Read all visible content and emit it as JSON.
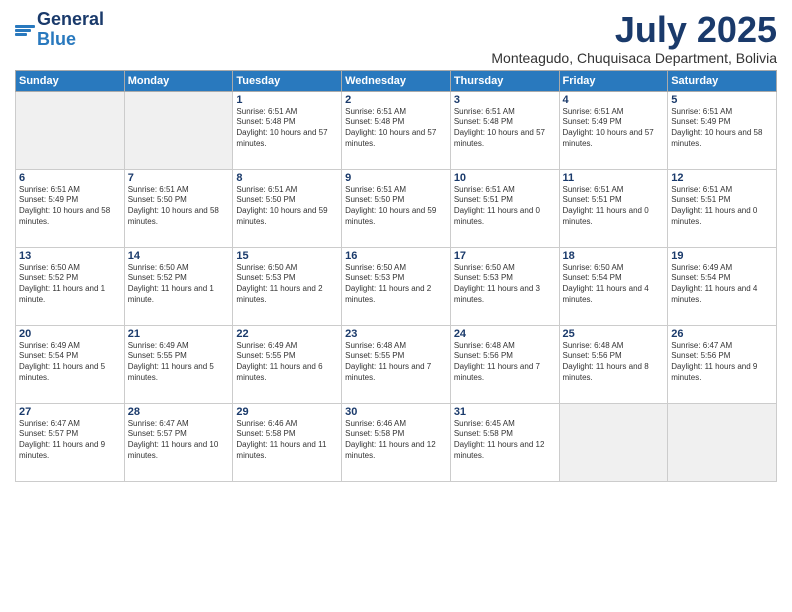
{
  "header": {
    "logo_general": "General",
    "logo_blue": "Blue",
    "month": "July 2025",
    "location": "Monteagudo, Chuquisaca Department, Bolivia"
  },
  "days_of_week": [
    "Sunday",
    "Monday",
    "Tuesday",
    "Wednesday",
    "Thursday",
    "Friday",
    "Saturday"
  ],
  "weeks": [
    [
      {
        "day": "",
        "empty": true
      },
      {
        "day": "",
        "empty": true
      },
      {
        "day": "1",
        "sunrise": "Sunrise: 6:51 AM",
        "sunset": "Sunset: 5:48 PM",
        "daylight": "Daylight: 10 hours and 57 minutes."
      },
      {
        "day": "2",
        "sunrise": "Sunrise: 6:51 AM",
        "sunset": "Sunset: 5:48 PM",
        "daylight": "Daylight: 10 hours and 57 minutes."
      },
      {
        "day": "3",
        "sunrise": "Sunrise: 6:51 AM",
        "sunset": "Sunset: 5:48 PM",
        "daylight": "Daylight: 10 hours and 57 minutes."
      },
      {
        "day": "4",
        "sunrise": "Sunrise: 6:51 AM",
        "sunset": "Sunset: 5:49 PM",
        "daylight": "Daylight: 10 hours and 57 minutes."
      },
      {
        "day": "5",
        "sunrise": "Sunrise: 6:51 AM",
        "sunset": "Sunset: 5:49 PM",
        "daylight": "Daylight: 10 hours and 58 minutes."
      }
    ],
    [
      {
        "day": "6",
        "sunrise": "Sunrise: 6:51 AM",
        "sunset": "Sunset: 5:49 PM",
        "daylight": "Daylight: 10 hours and 58 minutes."
      },
      {
        "day": "7",
        "sunrise": "Sunrise: 6:51 AM",
        "sunset": "Sunset: 5:50 PM",
        "daylight": "Daylight: 10 hours and 58 minutes."
      },
      {
        "day": "8",
        "sunrise": "Sunrise: 6:51 AM",
        "sunset": "Sunset: 5:50 PM",
        "daylight": "Daylight: 10 hours and 59 minutes."
      },
      {
        "day": "9",
        "sunrise": "Sunrise: 6:51 AM",
        "sunset": "Sunset: 5:50 PM",
        "daylight": "Daylight: 10 hours and 59 minutes."
      },
      {
        "day": "10",
        "sunrise": "Sunrise: 6:51 AM",
        "sunset": "Sunset: 5:51 PM",
        "daylight": "Daylight: 11 hours and 0 minutes."
      },
      {
        "day": "11",
        "sunrise": "Sunrise: 6:51 AM",
        "sunset": "Sunset: 5:51 PM",
        "daylight": "Daylight: 11 hours and 0 minutes."
      },
      {
        "day": "12",
        "sunrise": "Sunrise: 6:51 AM",
        "sunset": "Sunset: 5:51 PM",
        "daylight": "Daylight: 11 hours and 0 minutes."
      }
    ],
    [
      {
        "day": "13",
        "sunrise": "Sunrise: 6:50 AM",
        "sunset": "Sunset: 5:52 PM",
        "daylight": "Daylight: 11 hours and 1 minute."
      },
      {
        "day": "14",
        "sunrise": "Sunrise: 6:50 AM",
        "sunset": "Sunset: 5:52 PM",
        "daylight": "Daylight: 11 hours and 1 minute."
      },
      {
        "day": "15",
        "sunrise": "Sunrise: 6:50 AM",
        "sunset": "Sunset: 5:53 PM",
        "daylight": "Daylight: 11 hours and 2 minutes."
      },
      {
        "day": "16",
        "sunrise": "Sunrise: 6:50 AM",
        "sunset": "Sunset: 5:53 PM",
        "daylight": "Daylight: 11 hours and 2 minutes."
      },
      {
        "day": "17",
        "sunrise": "Sunrise: 6:50 AM",
        "sunset": "Sunset: 5:53 PM",
        "daylight": "Daylight: 11 hours and 3 minutes."
      },
      {
        "day": "18",
        "sunrise": "Sunrise: 6:50 AM",
        "sunset": "Sunset: 5:54 PM",
        "daylight": "Daylight: 11 hours and 4 minutes."
      },
      {
        "day": "19",
        "sunrise": "Sunrise: 6:49 AM",
        "sunset": "Sunset: 5:54 PM",
        "daylight": "Daylight: 11 hours and 4 minutes."
      }
    ],
    [
      {
        "day": "20",
        "sunrise": "Sunrise: 6:49 AM",
        "sunset": "Sunset: 5:54 PM",
        "daylight": "Daylight: 11 hours and 5 minutes."
      },
      {
        "day": "21",
        "sunrise": "Sunrise: 6:49 AM",
        "sunset": "Sunset: 5:55 PM",
        "daylight": "Daylight: 11 hours and 5 minutes."
      },
      {
        "day": "22",
        "sunrise": "Sunrise: 6:49 AM",
        "sunset": "Sunset: 5:55 PM",
        "daylight": "Daylight: 11 hours and 6 minutes."
      },
      {
        "day": "23",
        "sunrise": "Sunrise: 6:48 AM",
        "sunset": "Sunset: 5:55 PM",
        "daylight": "Daylight: 11 hours and 7 minutes."
      },
      {
        "day": "24",
        "sunrise": "Sunrise: 6:48 AM",
        "sunset": "Sunset: 5:56 PM",
        "daylight": "Daylight: 11 hours and 7 minutes."
      },
      {
        "day": "25",
        "sunrise": "Sunrise: 6:48 AM",
        "sunset": "Sunset: 5:56 PM",
        "daylight": "Daylight: 11 hours and 8 minutes."
      },
      {
        "day": "26",
        "sunrise": "Sunrise: 6:47 AM",
        "sunset": "Sunset: 5:56 PM",
        "daylight": "Daylight: 11 hours and 9 minutes."
      }
    ],
    [
      {
        "day": "27",
        "sunrise": "Sunrise: 6:47 AM",
        "sunset": "Sunset: 5:57 PM",
        "daylight": "Daylight: 11 hours and 9 minutes."
      },
      {
        "day": "28",
        "sunrise": "Sunrise: 6:47 AM",
        "sunset": "Sunset: 5:57 PM",
        "daylight": "Daylight: 11 hours and 10 minutes."
      },
      {
        "day": "29",
        "sunrise": "Sunrise: 6:46 AM",
        "sunset": "Sunset: 5:58 PM",
        "daylight": "Daylight: 11 hours and 11 minutes."
      },
      {
        "day": "30",
        "sunrise": "Sunrise: 6:46 AM",
        "sunset": "Sunset: 5:58 PM",
        "daylight": "Daylight: 11 hours and 12 minutes."
      },
      {
        "day": "31",
        "sunrise": "Sunrise: 6:45 AM",
        "sunset": "Sunset: 5:58 PM",
        "daylight": "Daylight: 11 hours and 12 minutes."
      },
      {
        "day": "",
        "empty": true
      },
      {
        "day": "",
        "empty": true
      }
    ]
  ]
}
